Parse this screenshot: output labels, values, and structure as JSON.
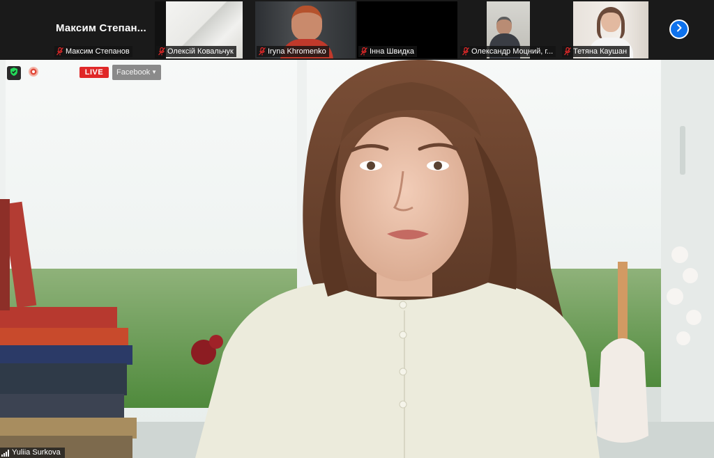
{
  "participants_strip": {
    "tiles": [
      {
        "big_name": "Максим  Степан...",
        "name": "Максим Степанов",
        "muted": true,
        "has_video": false
      },
      {
        "name": "Олексій Ковальчук",
        "muted": true,
        "has_video": true
      },
      {
        "name": "Iryna Khromenko",
        "muted": true,
        "has_video": true
      },
      {
        "name": "Інна Швидка",
        "muted": true,
        "has_video": false
      },
      {
        "name": "Олександр Моцний, г...",
        "muted": true,
        "has_video": true
      },
      {
        "name": "Тетяна Каушан",
        "muted": true,
        "has_video": true
      }
    ],
    "next_icon": "chevron-right-icon"
  },
  "main_view": {
    "live_label": "LIVE",
    "platform_label": "Facebook",
    "speaker_name": "Yuliia Surkova",
    "secure_icon": "shield-check-icon",
    "record_icon": "recording-icon"
  },
  "colors": {
    "accent": "#0e72ed",
    "live": "#e02828",
    "mute": "#e02828",
    "secure": "#23d959"
  }
}
